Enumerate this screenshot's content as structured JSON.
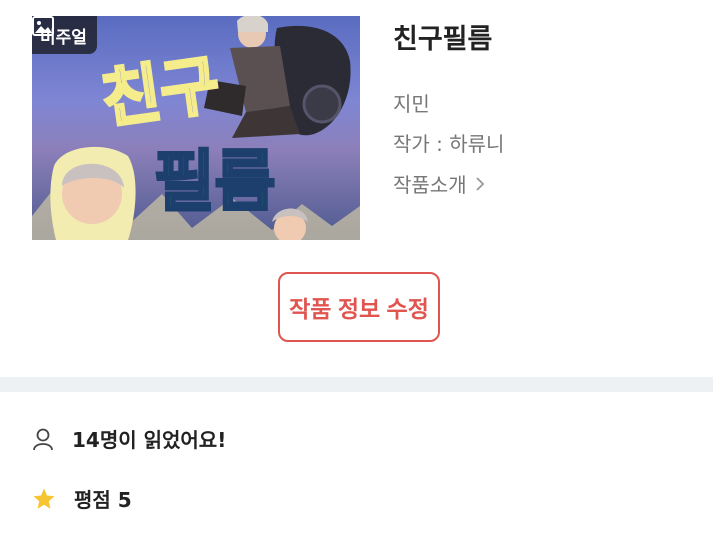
{
  "cover": {
    "badge_label": "비주얼",
    "badge_icon": "image-icon",
    "art_title_top": "친구",
    "art_title_bottom": "필름",
    "colors": {
      "title_glow": "#f5ec8c",
      "title_dark": "#2e6d62"
    }
  },
  "work": {
    "title": "친구필름",
    "subtitle": "지민",
    "author": "작가 : 하류니",
    "intro_label": "작품소개"
  },
  "actions": {
    "edit_label": "작품 정보 수정",
    "accent": "#e0554f"
  },
  "stats": {
    "readers_label": "14명이 읽었어요!",
    "readers_icon": "person-icon",
    "rating_label": "평점 5",
    "rating_icon": "star-icon",
    "star_color": "#f7c531"
  }
}
